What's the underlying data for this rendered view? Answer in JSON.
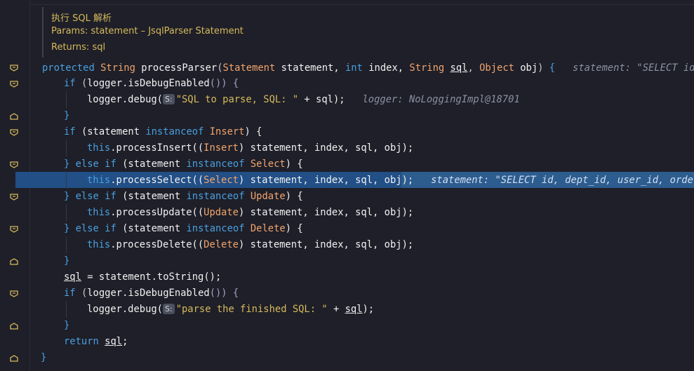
{
  "doc": {
    "title": "执行 SQL 解析",
    "params_label": "Params:",
    "params_name": "statement",
    "params_desc": "– JsqlParser Statement",
    "returns_label": "Returns:",
    "returns_value": "sql"
  },
  "code": {
    "line1": {
      "kw": "protected",
      "type": "String",
      "name": "processParser",
      "param1_type": "Statement",
      "param1": "statement,",
      "param2_type": "int",
      "param2": "index,",
      "param3_type": "String",
      "param3": "sql",
      "param4_type": "Object",
      "param4": "obj",
      "hint": "statement: \"SELECT id, dept_id, user_id, order_num"
    },
    "line2": {
      "kw": "if",
      "expr": "logger.isDebugEnabled",
      "rest": "()) {"
    },
    "line3": {
      "call": "logger.debug(",
      "badge": "S:",
      "str": "\"SQL to parse, SQL: \"",
      "rest": " + sql);",
      "hint": "logger: NoLoggingImpl@18701"
    },
    "line4": {
      "text": "}"
    },
    "line5": {
      "kw": "if",
      "a": "(statement ",
      "kw2": "instanceof",
      "type": "Insert",
      "rest": ") {"
    },
    "line6": {
      "kw": "this",
      "rest": ".processInsert((",
      "type": "Insert",
      "rest2": ") statement, index, sql, obj);"
    },
    "line7": {
      "a": "} ",
      "kw": "else if",
      "b": " (statement ",
      "kw2": "instanceof",
      "type": "Select",
      "rest": ") {"
    },
    "line8": {
      "kw": "this",
      "rest": ".processSelect((",
      "type": "Select",
      "rest2": ") statement, index, sql, obj);",
      "hint": "statement: \"SELECT id, dept_id, user_id, order_num"
    },
    "line9": {
      "a": "} ",
      "kw": "else if",
      "b": " (statement ",
      "kw2": "instanceof",
      "type": "Update",
      "rest": ") {"
    },
    "line10": {
      "kw": "this",
      "rest": ".processUpdate((",
      "type": "Update",
      "rest2": ") statement, index, sql, obj);"
    },
    "line11": {
      "a": "} ",
      "kw": "else if",
      "b": " (statement ",
      "kw2": "instanceof",
      "type": "Delete",
      "rest": ") {"
    },
    "line12": {
      "kw": "this",
      "rest": ".processDelete((",
      "type": "Delete",
      "rest2": ") statement, index, sql, obj);"
    },
    "line13": {
      "text": "}"
    },
    "line14": {
      "var": "sql",
      "rest": " = statement.toString();"
    },
    "line15": {
      "kw": "if",
      "expr": "logger.isDebugEnabled",
      "rest": "()) {"
    },
    "line16": {
      "call": "logger.debug(",
      "badge": "S:",
      "str": "\"parse the finished SQL: \"",
      "mid": " + ",
      "var": "sql",
      "rest": ");"
    },
    "line17": {
      "text": "}"
    },
    "line18": {
      "kw": "return",
      "var": "sql",
      "rest": ";"
    },
    "line19": {
      "text": "}"
    }
  }
}
